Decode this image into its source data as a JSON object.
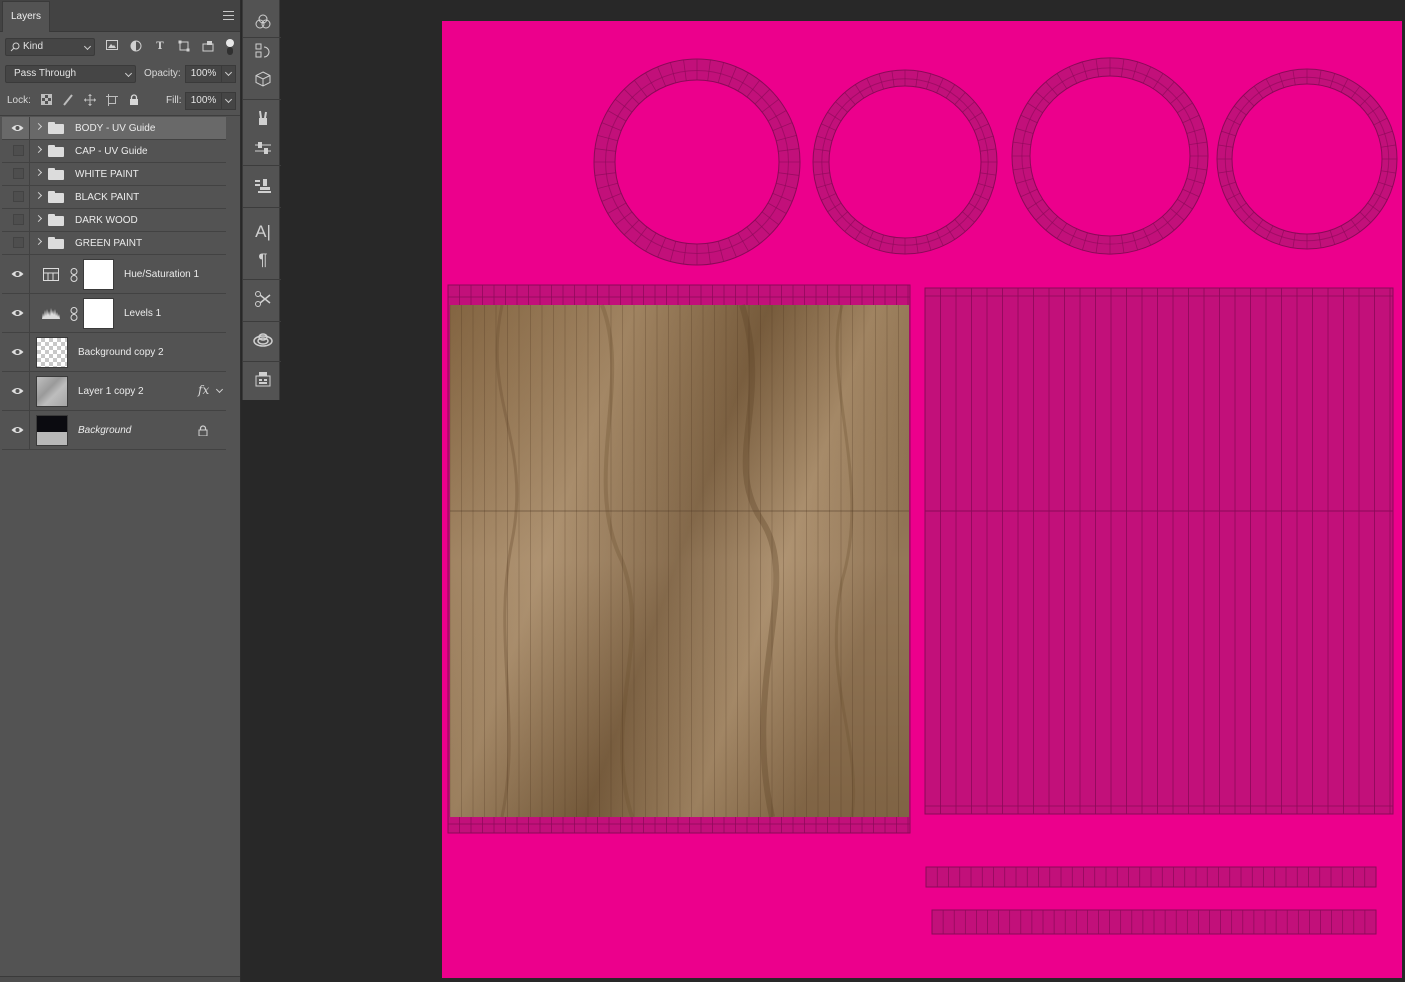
{
  "panel": {
    "tab_label": "Layers",
    "filter_kind": "Kind",
    "blend_mode": "Pass Through",
    "opacity_label": "Opacity:",
    "opacity_value": "100%",
    "lock_label": "Lock:",
    "fill_label": "Fill:",
    "fill_value": "100%"
  },
  "layers": [
    {
      "name": "BODY - UV Guide",
      "type": "group",
      "visible": true,
      "selected": true
    },
    {
      "name": "CAP - UV Guide",
      "type": "group",
      "visible": false
    },
    {
      "name": "WHITE PAINT",
      "type": "group",
      "visible": false
    },
    {
      "name": "BLACK PAINT",
      "type": "group",
      "visible": false
    },
    {
      "name": "DARK WOOD",
      "type": "group",
      "visible": false
    },
    {
      "name": "GREEN PAINT",
      "type": "group",
      "visible": false
    },
    {
      "name": "Hue/Saturation 1",
      "type": "adjustment",
      "visible": true
    },
    {
      "name": "Levels 1",
      "type": "adjustment",
      "visible": true
    },
    {
      "name": "Background copy 2",
      "type": "pixel",
      "visible": true
    },
    {
      "name": "Layer 1 copy 2",
      "type": "pixel",
      "visible": true,
      "fx": "fx"
    },
    {
      "name": "Background",
      "type": "background",
      "visible": true,
      "locked": true
    }
  ],
  "colors": {
    "document_bg": "#ec008c",
    "uv_shell": "#c2107a",
    "uv_line": "#8a0a58",
    "wood_light": "#a88a66",
    "wood_dark": "#7c5f3e"
  },
  "icons": {
    "search": "search-icon",
    "image_filter": "image-filter-icon",
    "adjustment_filter": "adjustment-filter-icon",
    "type_filter": "type-filter-icon",
    "shape_filter": "shape-filter-icon",
    "smart_object_filter": "smart-object-filter-icon"
  }
}
